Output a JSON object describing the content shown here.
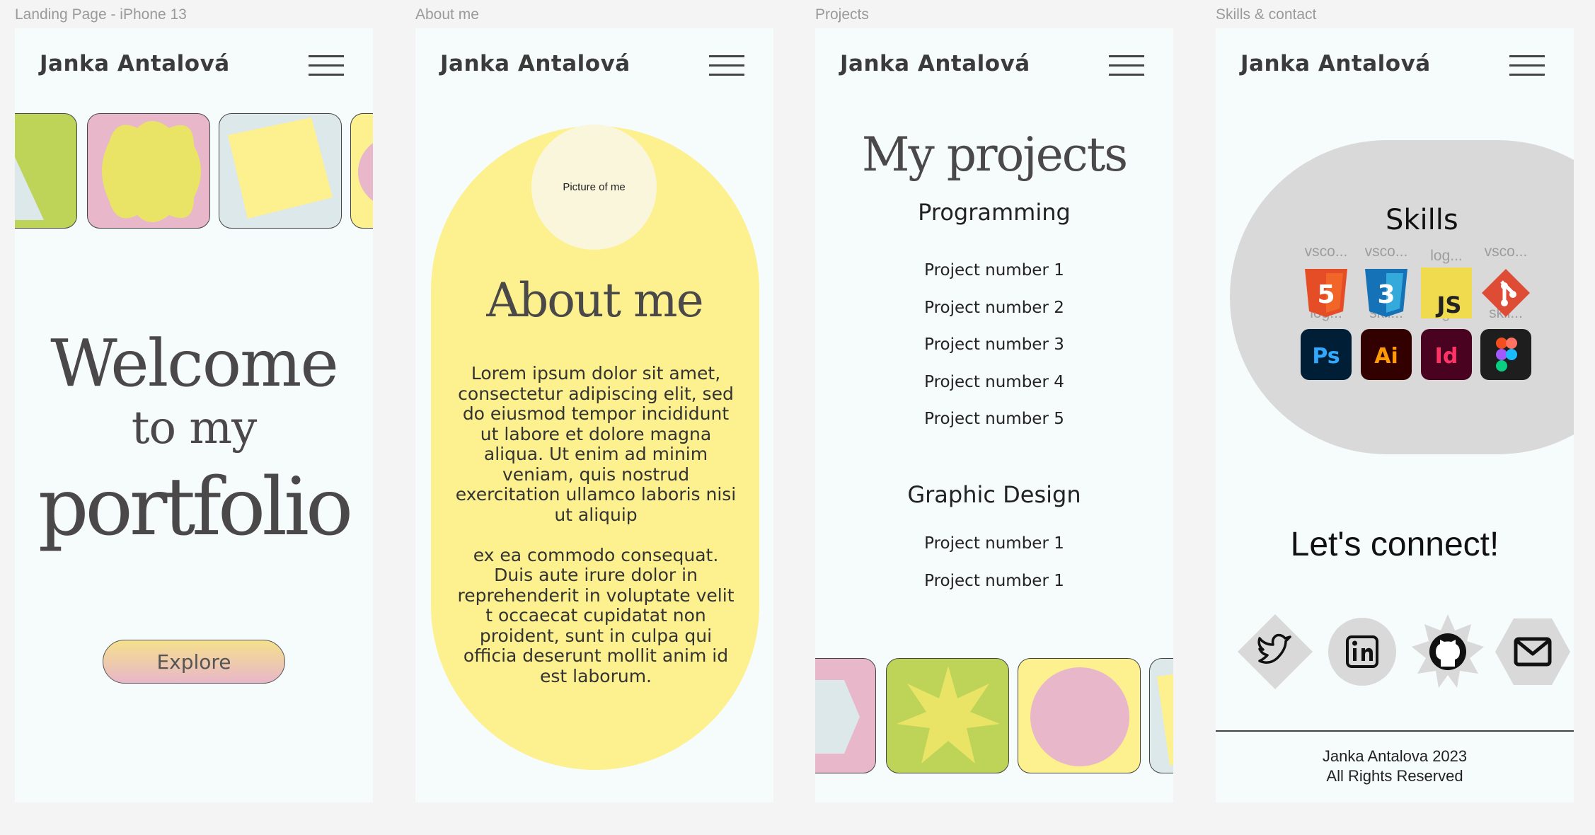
{
  "frames": {
    "landing": "Landing Page - iPhone 13",
    "about": "About me",
    "projects": "Projects",
    "skills": "Skills & contact"
  },
  "brand": "Janka Antalová",
  "landing": {
    "line1": "Welcome",
    "line2": "to my",
    "line3": "portfolio",
    "cta": "Explore"
  },
  "about": {
    "photo": "Picture of me",
    "title": "About me",
    "p1": "Lorem ipsum dolor sit amet, consectetur adipiscing elit, sed do eiusmod tempor incididunt ut labore et dolore magna aliqua. Ut enim ad minim veniam, quis nostrud exercitation ullamco laboris nisi ut aliquip",
    "p2": "ex ea commodo consequat. Duis aute irure dolor in reprehenderit in voluptate velit t occaecat cupidatat non proident, sunt in culpa qui officia deserunt mollit anim id est laborum."
  },
  "projects": {
    "title": "My projects",
    "programming": {
      "heading": "Programming",
      "items": [
        "Project number 1",
        "Project number 2",
        "Project number 3",
        "Project number 4",
        "Project number 5"
      ]
    },
    "design": {
      "heading": "Graphic Design",
      "items": [
        "Project number 1",
        "Project number 1"
      ]
    }
  },
  "skills": {
    "title": "Skills",
    "captions": [
      "vsco...",
      "vsco...",
      "log...",
      "vsco...",
      "log...",
      "skil...",
      "log...",
      "skil..."
    ],
    "icons": [
      {
        "name": "html5-icon",
        "label": "5",
        "color": "#e44d26"
      },
      {
        "name": "css3-icon",
        "label": "3",
        "color": "#2965f1"
      },
      {
        "name": "javascript-icon",
        "label": "JS",
        "color": "#f0db4f"
      },
      {
        "name": "git-icon",
        "label": "",
        "color": "#de4c36"
      },
      {
        "name": "photoshop-icon",
        "label": "Ps",
        "color": "#31a8ff"
      },
      {
        "name": "illustrator-icon",
        "label": "Ai",
        "color": "#ff9a00"
      },
      {
        "name": "indesign-icon",
        "label": "Id",
        "color": "#ff3366"
      },
      {
        "name": "figma-icon",
        "label": "",
        "color": "#1e1e1e"
      }
    ],
    "connect": "Let's connect!",
    "social": [
      "twitter-icon",
      "linkedin-icon",
      "github-icon",
      "mail-icon"
    ],
    "footer1": "Janka Antalova 2023",
    "footer2": "All Rights Reserved"
  },
  "colors": {
    "background": "#f6fbfb",
    "yellow": "#fdf08e",
    "pink": "#e8b7c9",
    "green": "#bdd458",
    "grey": "#d9d9d9"
  }
}
